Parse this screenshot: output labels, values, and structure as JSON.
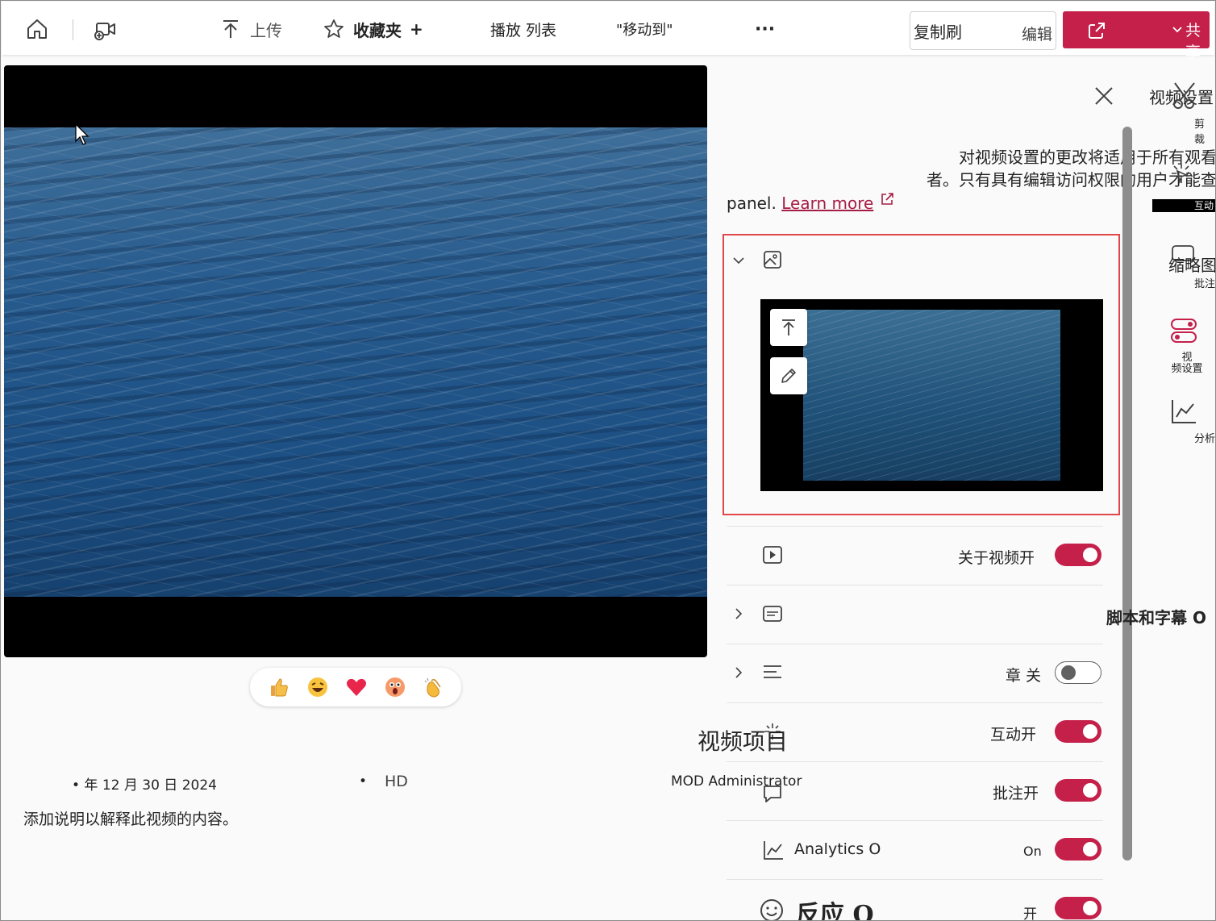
{
  "toolbar": {
    "upload": "上传",
    "favorites": "收藏夹",
    "favorites_plus": "+",
    "playlist": "播放 列表",
    "move_to": "\"移动到\"",
    "more": "···",
    "copy_link": "复制刷",
    "edit": "编辑",
    "share": "共享"
  },
  "video": {
    "reactions": [
      "thumbs-up",
      "laughing",
      "heart",
      "surprised",
      "clapping"
    ],
    "date": "• 年 12 月 30 日 2024",
    "dot": "•",
    "quality": "HD",
    "owner": "MOD Administrator",
    "description": "添加说明以解释此视频的内容。"
  },
  "panel": {
    "title": "视频设置",
    "note_line1": "对视频设置的更改将适用于所有观看",
    "note_line2": "者。只有具有编辑访问权限的用户才能查",
    "note_line3": "panel.",
    "learn_more": "Learn more",
    "thumbnail_label": "缩略图",
    "rows": [
      {
        "label": "关于视频开",
        "state": "on"
      },
      {
        "label": "脚本和字幕 O",
        "state": "none"
      },
      {
        "label": "章 关",
        "state": "off"
      },
      {
        "label": "互动开",
        "state": "on",
        "overlay": "视频项目"
      },
      {
        "label": "批注开",
        "state": "on"
      },
      {
        "label": "Analytics O",
        "state_text": "On",
        "state": "on"
      },
      {
        "label": "反应 O",
        "state_text": "开",
        "state": "on"
      }
    ]
  },
  "rail": {
    "trim": "剪裁",
    "interaction": "互动",
    "comments": "批注",
    "settings": "视\n频设置",
    "analytics": "分析"
  },
  "colors": {
    "accent": "#c4204a",
    "highlight_border": "#e0464a",
    "link": "#a61e45"
  }
}
